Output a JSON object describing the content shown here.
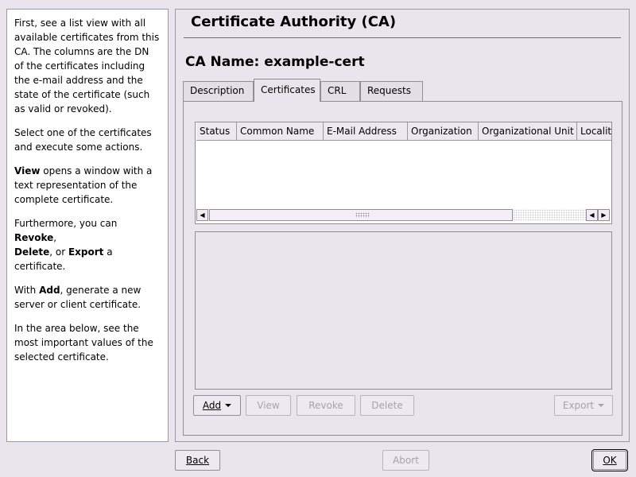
{
  "help": {
    "p1": "First, see a list view with all available certificates from this CA. The columns are the DN of the certificates including the e-mail address and the state of the certificate (such as valid or revoked).",
    "p2": "Select one of the certificates and execute some actions.",
    "p3_bold": "View",
    "p3_rest": " opens a window with a text representation of the complete certificate.",
    "p4_a": "Furthermore, you can ",
    "p4_revoke": "Revoke",
    "p4_b": ",",
    "p4_delete": "Delete",
    "p4_c": ", or ",
    "p4_export": "Export",
    "p4_d": " a certificate.",
    "p5_a": "With ",
    "p5_add": "Add",
    "p5_b": ", generate a new server or client certificate.",
    "p6": "In the area below, see the most important values of the selected certificate."
  },
  "dialog": {
    "title": "Certificate Authority (CA)",
    "ca_name": "CA Name: example-cert"
  },
  "tabs": [
    {
      "label": "Description",
      "active": false
    },
    {
      "label": "Certificates",
      "active": true
    },
    {
      "label": "CRL",
      "active": false
    },
    {
      "label": "Requests",
      "active": false
    }
  ],
  "table": {
    "columns": [
      "Status",
      "Common Name",
      "E-Mail Address",
      "Organization",
      "Organizational Unit",
      "Localit"
    ],
    "rows": []
  },
  "actions": {
    "add": {
      "label": "Add",
      "enabled": true
    },
    "view": {
      "label": "View",
      "enabled": false
    },
    "revoke": {
      "label": "Revoke",
      "enabled": false
    },
    "delete": {
      "label": "Delete",
      "enabled": false
    },
    "export": {
      "label": "Export",
      "enabled": false
    }
  },
  "footer": {
    "back": "Back",
    "abort": "Abort",
    "ok": "OK"
  }
}
